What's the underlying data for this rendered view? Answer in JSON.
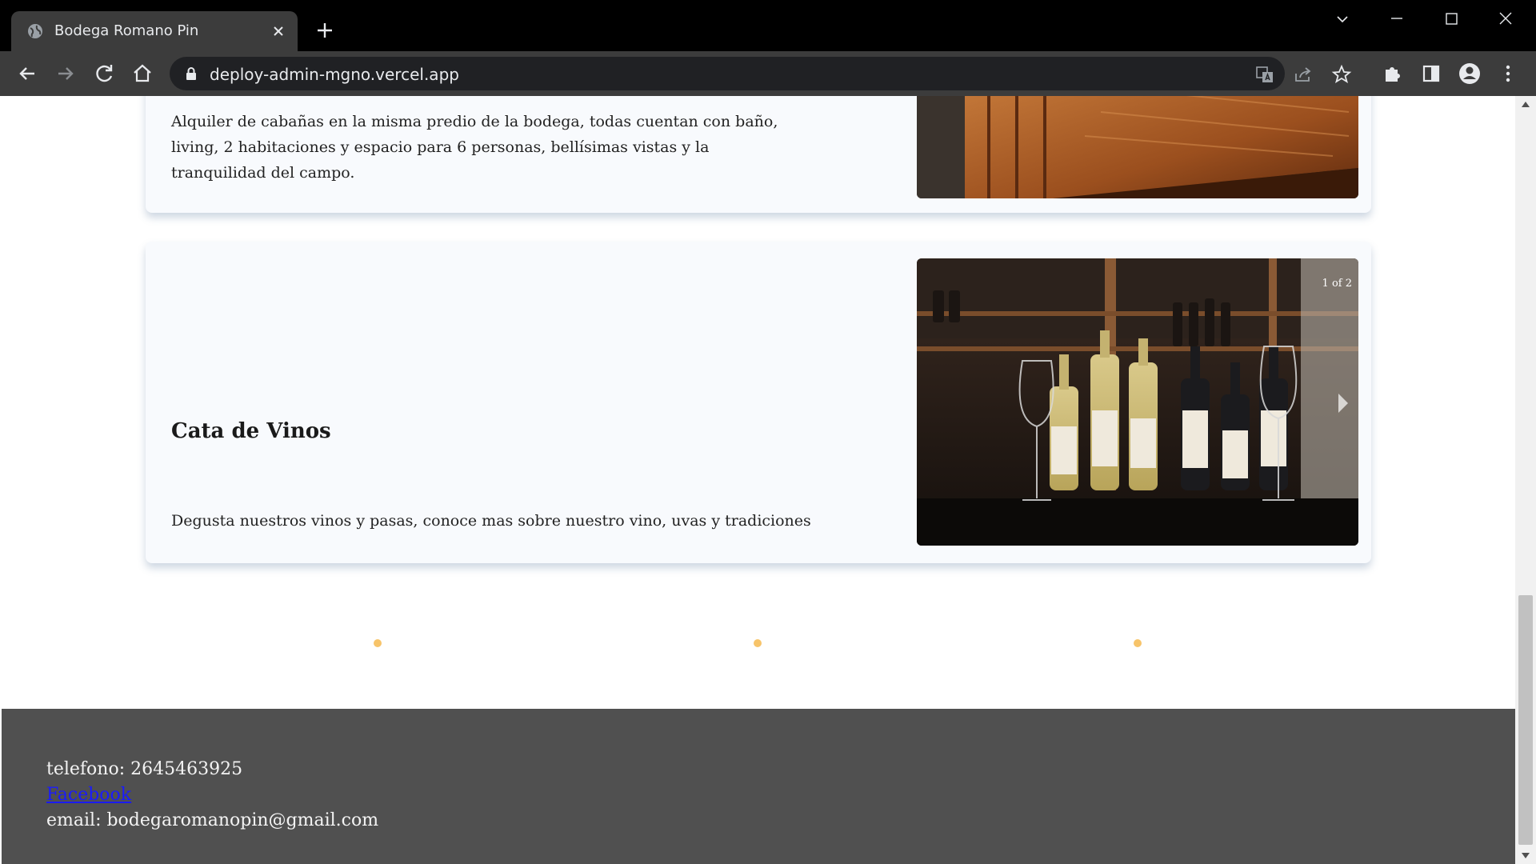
{
  "browser": {
    "tab_title": "Bodega Romano Pin",
    "url": "deploy-admin-mgno.vercel.app"
  },
  "cards": [
    {
      "title": "",
      "description": "Alquiler de cabañas en la misma predio de la bodega, todas cuentan con baño, living, 2 habitaciones y espacio para 6 personas, bellísimas vistas y la tranquilidad del campo.",
      "image": "wooden-cabin-furniture"
    },
    {
      "title": "Cata de Vinos",
      "description": "Degusta nuestros vinos y pasas, conoce mas sobre nuestro vino, uvas y tradiciones",
      "image": "wine-bottles-and-glasses",
      "carousel_counter": "1 of 2"
    }
  ],
  "footer": {
    "phone": "telefono: 2645463925",
    "facebook_label": "Facebook",
    "email": "email: bodegaromanopin@gmail.com"
  },
  "colors": {
    "accent_dots": "#f7c46a",
    "footer_bg": "#505050",
    "card_bg": "#f8fafd"
  }
}
